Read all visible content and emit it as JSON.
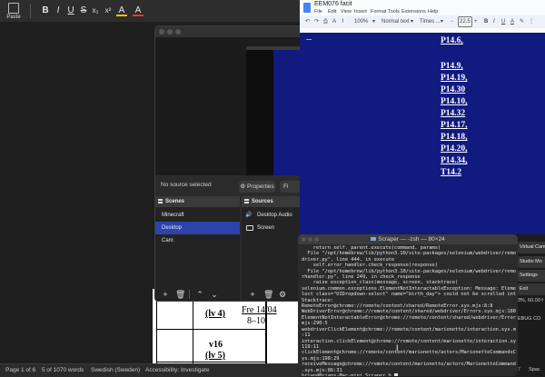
{
  "word": {
    "paste_label": "Paste",
    "format_buttons": [
      "B",
      "I",
      "U",
      "S",
      "x₂",
      "x²",
      "A",
      "A"
    ],
    "page_rows": [
      {
        "left": "(lv 4)",
        "right_line1": "Fre 14/04",
        "right_line2": "8–10"
      },
      {
        "left_line1": "v16",
        "left_line2": "(lv 5)"
      }
    ],
    "status": {
      "page": "Page 1 of 6",
      "words": "5 of 1070 words",
      "language": "Swedish (Sweden)",
      "accessibility": "Accessibility: Investigate"
    }
  },
  "obs": {
    "no_source_text": "No source selected",
    "properties_label": "Properties",
    "filters_label": "Fi",
    "scenes_header": "Scenes",
    "sources_header": "Sources",
    "scenes": [
      {
        "label": "Minecraft",
        "selected": false
      },
      {
        "label": "Desktop",
        "selected": true
      },
      {
        "label": "Cam",
        "selected": false
      }
    ],
    "sources": [
      {
        "label": "Desktop Audio",
        "icon": "speaker-icon"
      },
      {
        "label": "Screen",
        "icon": "monitor-icon"
      }
    ],
    "selection_color": "#2c43aa"
  },
  "gdocs": {
    "title": "EEM076 facit",
    "menu": [
      "File",
      "Edit",
      "View",
      "Insert",
      "Format",
      "Tools",
      "Extensions",
      "Help"
    ],
    "zoom": "100%",
    "style": "Normal text",
    "font": "Times ...",
    "font_size": "22.5",
    "background_color": "#111a7e",
    "items": [
      "P14.6,",
      "P14.9,",
      "P14.19,",
      "P14.30",
      "P14.10,",
      "P14.32",
      "P14.17,",
      "P14.18,",
      "P14.20,",
      "P14.34,",
      "T14.2"
    ]
  },
  "obs_controls": {
    "virtual_cam": "Virtual Cam",
    "studio_mode": "Studio Mo",
    "settings": "Settings",
    "exit": "Exit",
    "stats": "3%, 60.00 f",
    "debug": "EBUG CO",
    "spaces": "Spac",
    "number": "7"
  },
  "terminal": {
    "title": "Scraper — -zsh — 80×24",
    "lines": [
      "    return self._parent.execute(command, params)",
      "  File \"/opt/homebrew/lib/python3.10/site-packages/selenium/webdriver/remote/web",
      "driver.py\", line 444, in execute",
      "    self.error_handler.check_response(response)",
      "  File \"/opt/homebrew/lib/python3.10/site-packages/selenium/webdriver/remote/erro",
      "rhandler.py\", line 249, in check_response",
      "    raise exception_class(message, screen, stacktrace)",
      "selenium.common.exceptions.ElementNotInteractableException: Message: Element <se",
      "lect class=\"UIDropdown-select\" name=\"birth_day\"> could not be scrolled into view",
      "Stacktrace:",
      "RemoteError@chrome://remote/content/shared/RemoteError.sys.mjs:8:8",
      "WebDriverError@chrome://remote/content/shared/webdriver/Errors.sys.mjs:180:5",
      "ElementNotInteractableError@chrome://remote/content/shared/webdriver/Errors.sys.",
      "mjs:290:5",
      "webdriverClickElement@chrome://remote/content/marionette/interaction.sys.mjs:150",
      ":11",
      "interaction.clickElement@chrome://remote/content/marionette/interaction.sys.mjs:",
      "119:11",
      "clickElement@chrome://remote/content/marionette/actors/MarionetteCommandsChild.s",
      "ys.mjs:198:29",
      "receiveMessage@chrome://remote/content/marionette/actors/MarionetteCommandsChild",
      ".sys.mjs:86:31",
      "brian@Brians-Mac-mini Scraper % "
    ]
  }
}
